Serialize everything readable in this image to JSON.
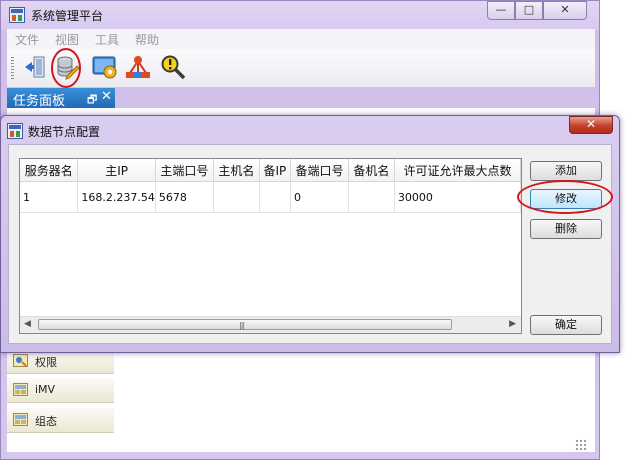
{
  "main_window": {
    "title": "系统管理平台",
    "minimize": "—",
    "maximize": "□",
    "close": "✕"
  },
  "menu": [
    "文件",
    "视图",
    "工具",
    "帮助"
  ],
  "toolbar": {
    "buttons": [
      "exit-icon",
      "database-config-icon",
      "settings-icon",
      "network-topology-icon",
      "diagnose-icon"
    ]
  },
  "task_panel": {
    "title": "任务面板",
    "pin": "🗗",
    "close": "✕",
    "nav_items": [
      "权限",
      "iMV",
      "组态"
    ]
  },
  "dialog": {
    "title": "数据节点配置",
    "close": "✕",
    "table": {
      "columns": [
        "服务器名",
        "主IP",
        "主端口号",
        "主机名",
        "备IP",
        "备端口号",
        "备机名",
        "许可证允许最大点数"
      ],
      "rows": [
        [
          "1",
          "168.2.237.54",
          "5678",
          "",
          "",
          "0",
          "",
          "30000"
        ]
      ]
    },
    "buttons": {
      "add": "添加",
      "modify": "修改",
      "delete": "删除",
      "ok": "确定"
    },
    "scrollbar": {
      "left": "◀",
      "right": "▶",
      "grip": "|||"
    }
  },
  "colors": {
    "titlebar": "#d9cdf0",
    "task_panel_header": "#2a79c6",
    "highlight": "#d2161c"
  }
}
